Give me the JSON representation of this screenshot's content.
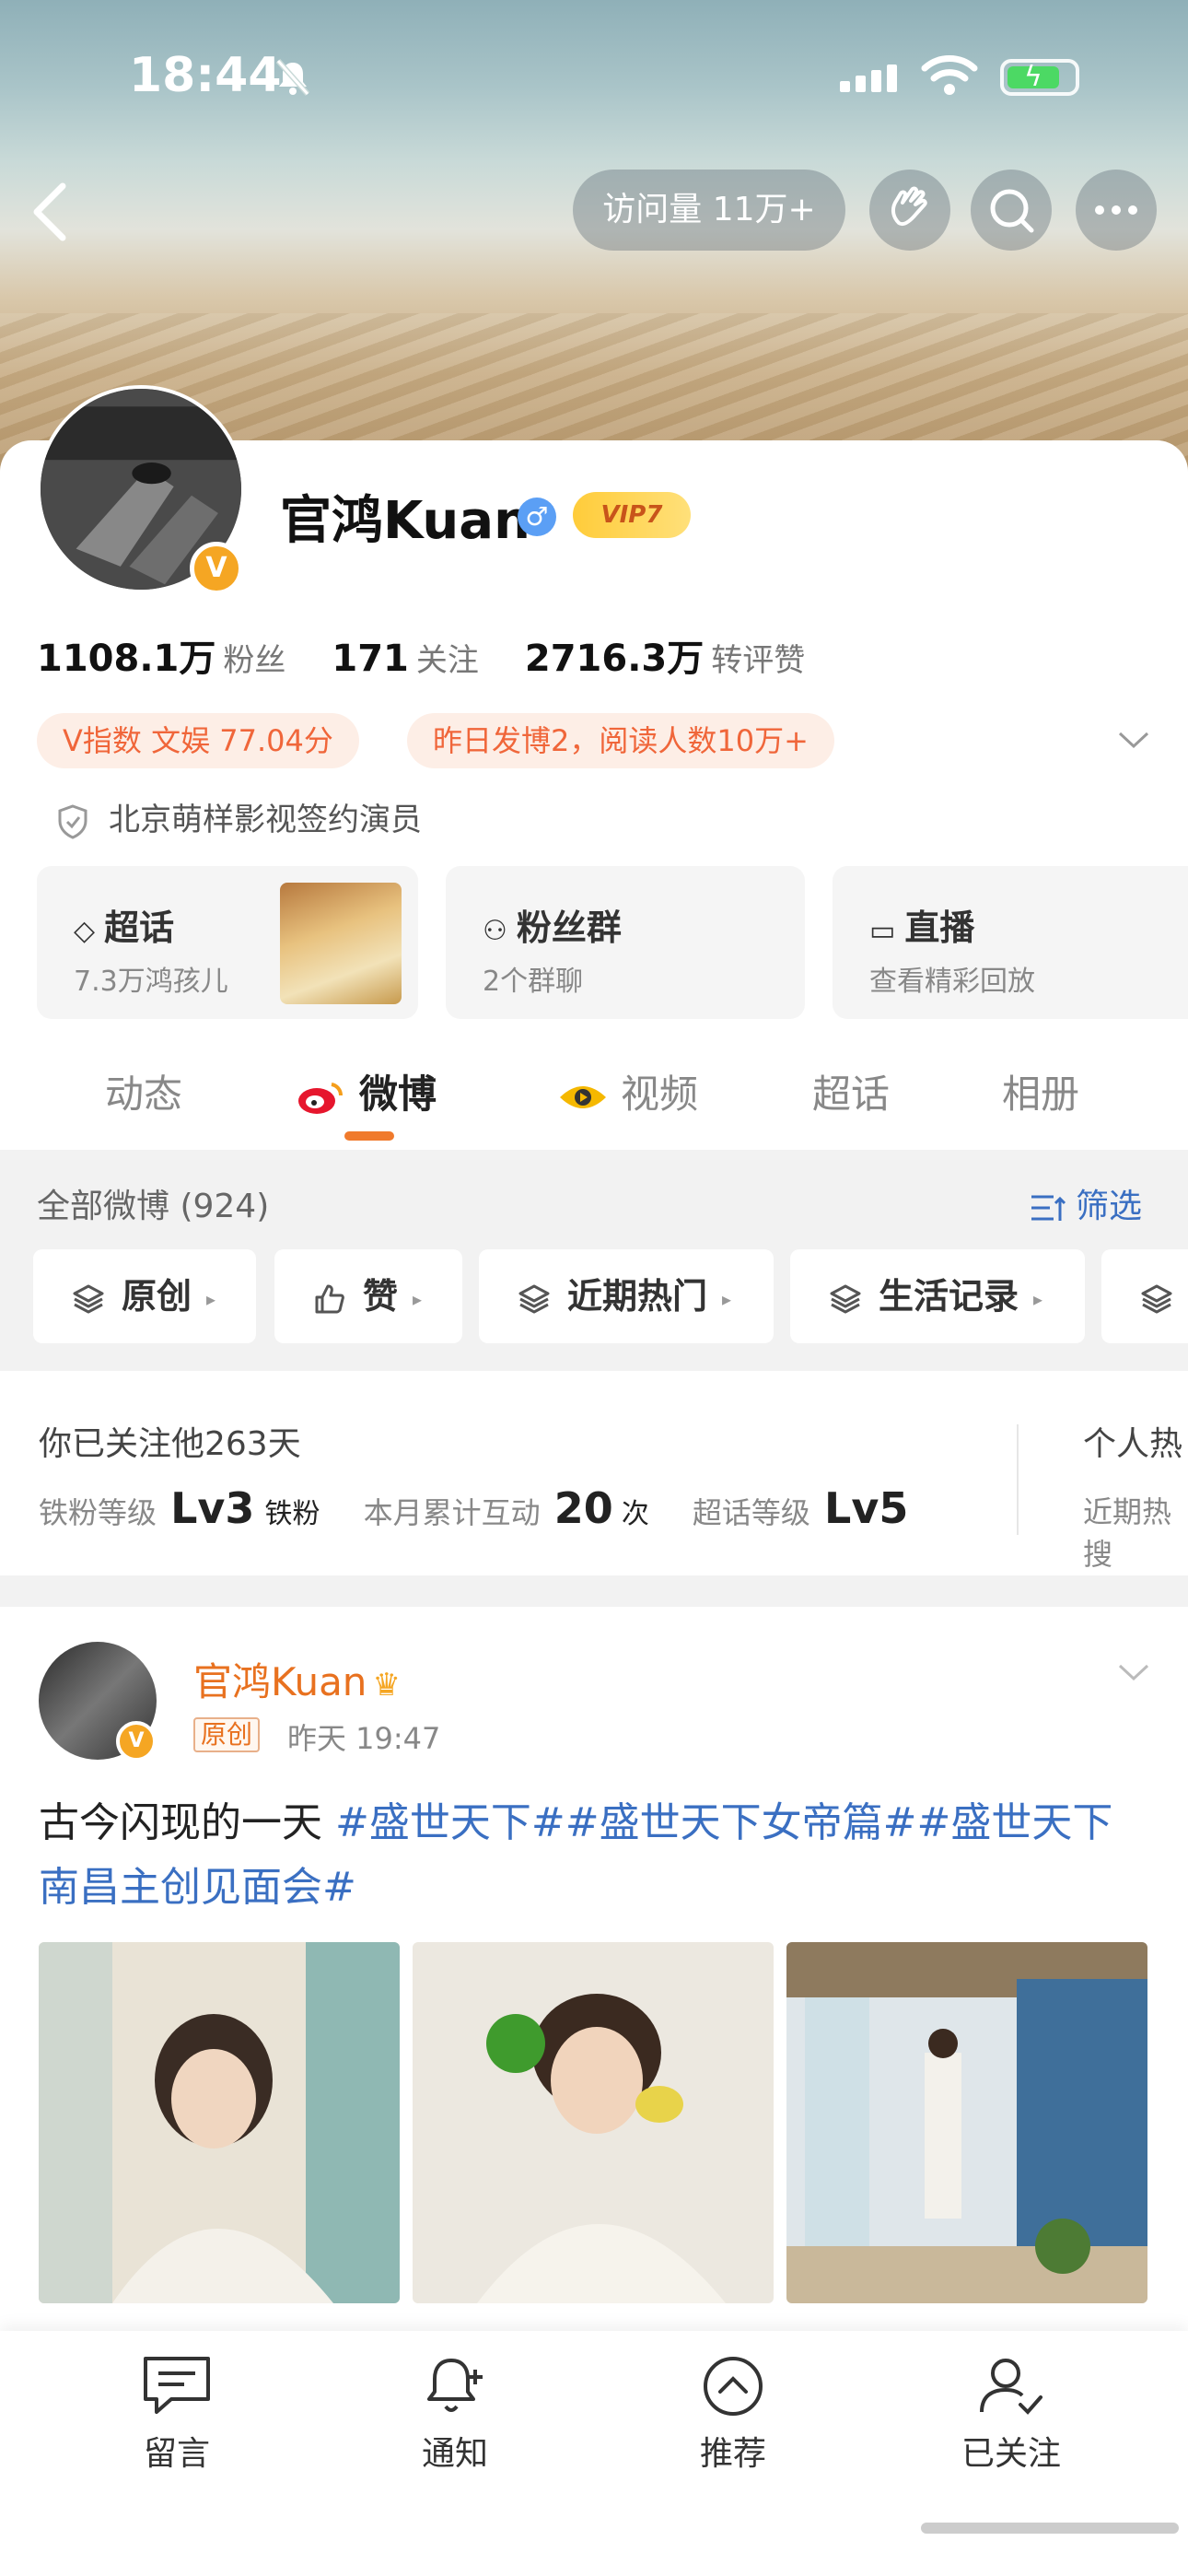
{
  "status_bar": {
    "time": "18:44"
  },
  "header": {
    "visits_label": "访问量 11万+"
  },
  "profile": {
    "name": "官鸿Kuan",
    "vip_badge": "VIP7",
    "avatar_badge": "V",
    "stats": [
      {
        "value": "1108.1万",
        "label": "粉丝"
      },
      {
        "value": "171",
        "label": "关注"
      },
      {
        "value": "2716.3万",
        "label": "转评赞"
      }
    ],
    "tags": [
      "V指数 文娱 77.04分",
      "昨日发博2，阅读人数10万+"
    ],
    "verification": "北京萌样影视签约演员"
  },
  "feature_boxes": [
    {
      "title": "超话",
      "subtitle": "7.3万鸿孩儿"
    },
    {
      "title": "粉丝群",
      "subtitle": "2个群聊"
    },
    {
      "title": "直播",
      "subtitle": "查看精彩回放"
    }
  ],
  "tabs": [
    "动态",
    "微博",
    "视频",
    "超话",
    "相册"
  ],
  "feed_header": {
    "count_label": "全部微博 (924)",
    "filter_label": "筛选",
    "chips": [
      "原创",
      "赞",
      "近期热门",
      "生活记录"
    ]
  },
  "fan_info": {
    "followed_days": "你已关注他263天",
    "iron_fan_label": "铁粉等级",
    "iron_fan_level": "Lv3",
    "iron_fan_suffix": "铁粉",
    "interaction_label": "本月累计互动",
    "interaction_count": "20",
    "interaction_unit": "次",
    "topic_level_label": "超话等级",
    "topic_level": "Lv5",
    "right_title": "个人热",
    "right_sub": "近期热搜"
  },
  "post": {
    "author": "官鸿Kuan",
    "original_tag": "原创",
    "time": "昨天 19:47",
    "text_plain": "古今闪现的一天 ",
    "text_topics": "#盛世天下##盛世天下女帝篇##盛世天下南昌主创见面会#"
  },
  "bottom_bar": [
    "留言",
    "通知",
    "推荐",
    "已关注"
  ],
  "colors": {
    "accent": "#f07a2c",
    "link": "#3a6fc2",
    "author": "#e8711f"
  }
}
